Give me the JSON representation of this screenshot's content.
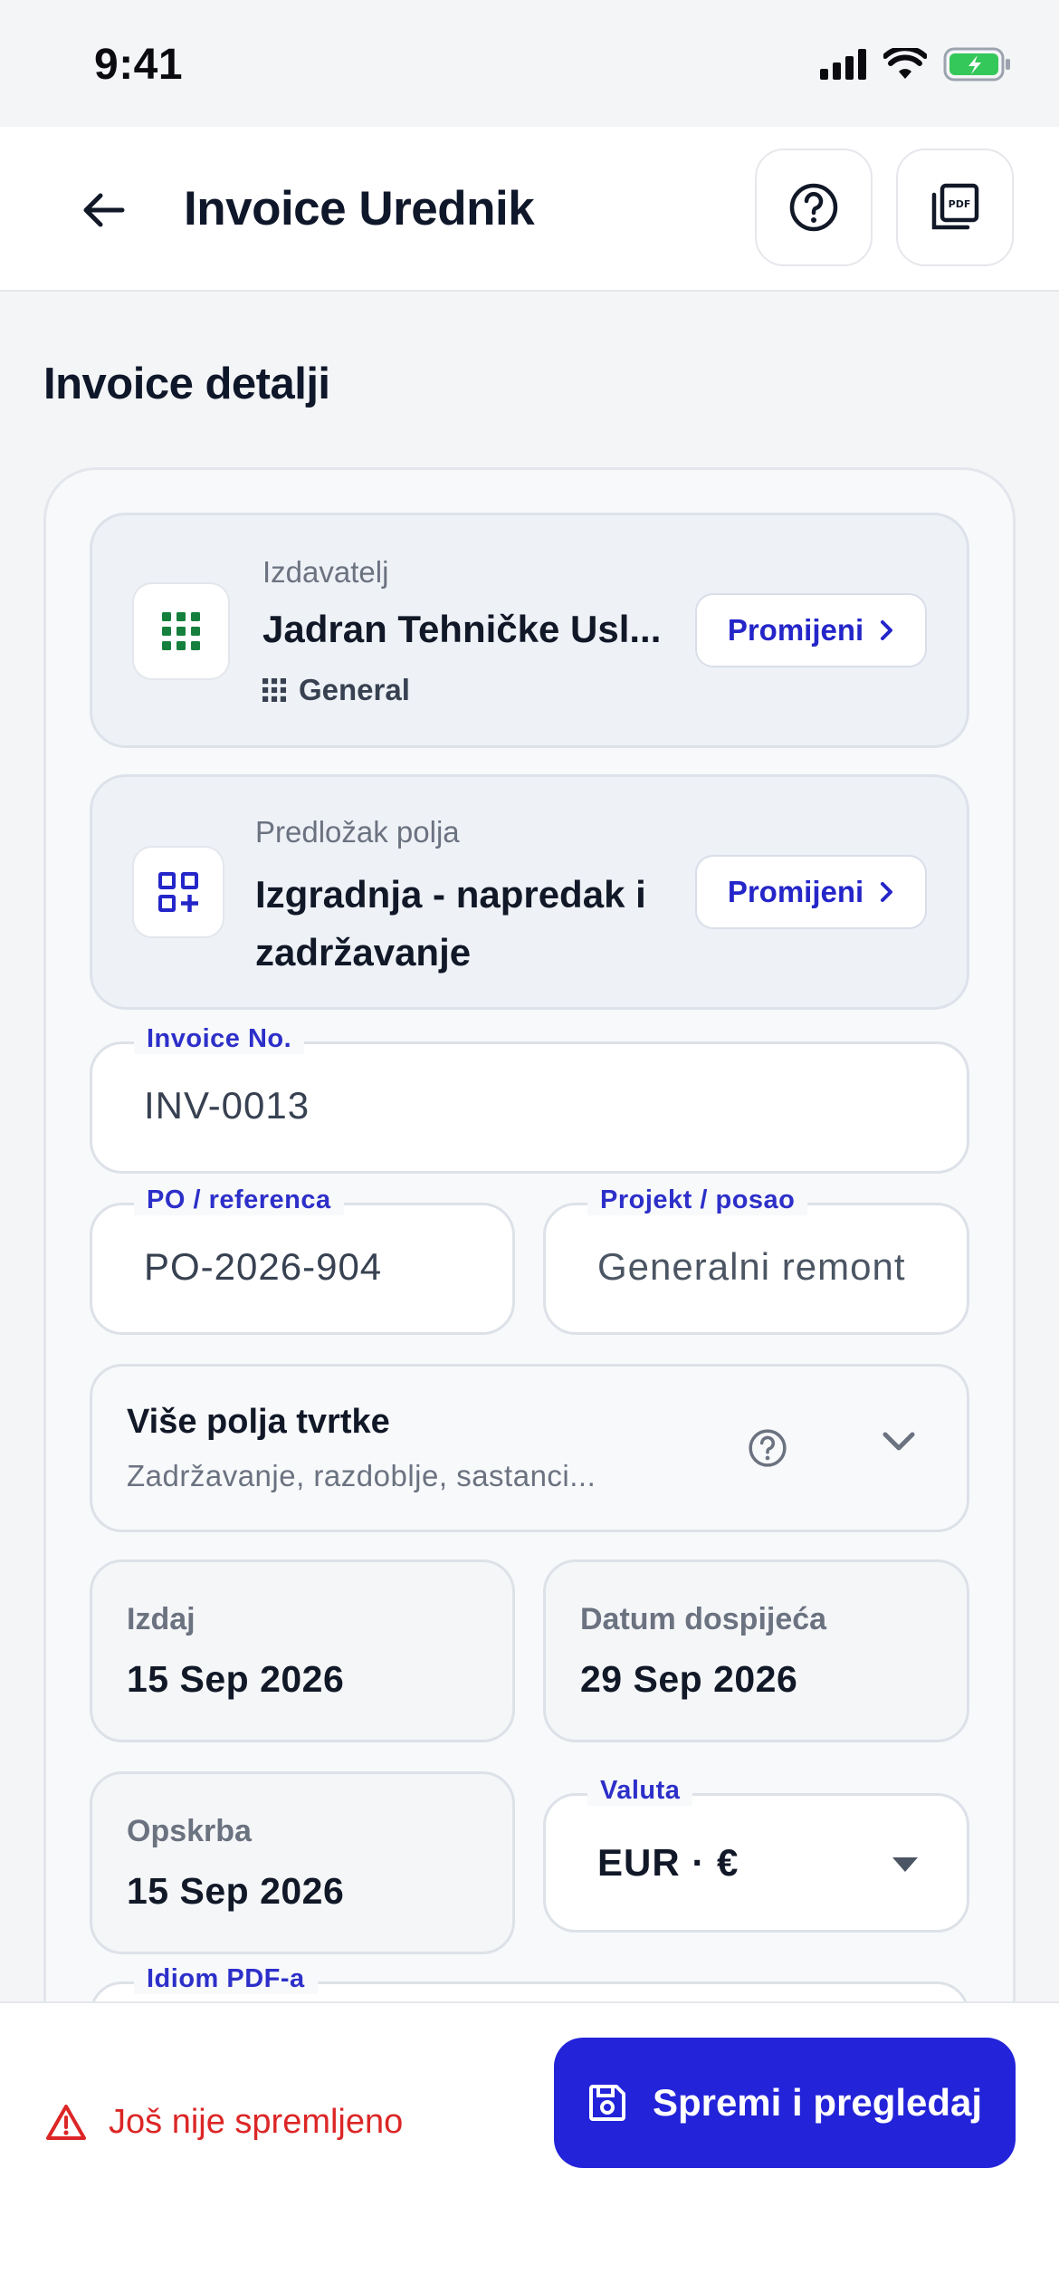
{
  "status_bar": {
    "time": "9:41"
  },
  "app_bar": {
    "title": "Invoice Urednik"
  },
  "section": {
    "title": "Invoice detalji"
  },
  "issuer": {
    "label": "Izdavatelj",
    "name": "Jadran Tehničke Usl...",
    "sub": "General",
    "change_label": "Promijeni"
  },
  "template": {
    "label": "Predložak polja",
    "name": "Izgradnja - napredak i zadržavanje",
    "change_label": "Promijeni"
  },
  "fields": {
    "invoice_no": {
      "label": "Invoice No.",
      "value": "INV-0013"
    },
    "po": {
      "label": "PO / referenca",
      "value": "PO-2026-904"
    },
    "project": {
      "label": "Projekt / posao",
      "value": "Generalni remont"
    },
    "currency": {
      "label": "Valuta",
      "value": "EUR · €"
    },
    "idiom": {
      "label": "Idiom PDF-a"
    }
  },
  "more_fields": {
    "title": "Više polja tvrtke",
    "subtitle": "Zadržavanje, razdoblje, sastanci..."
  },
  "dates": {
    "issue": {
      "label": "Izdaj",
      "value": "15 Sep 2026"
    },
    "due": {
      "label": "Datum dospijeća",
      "value": "29 Sep 2026"
    },
    "supply": {
      "label": "Opskrba",
      "value": "15 Sep 2026"
    }
  },
  "footer": {
    "unsaved": "Još nije spremljeno",
    "save_label": "Spremi i pregledaj"
  },
  "colors": {
    "accent": "#2323d9",
    "warning": "#dc2626",
    "issuer_icon": "#15803d"
  }
}
